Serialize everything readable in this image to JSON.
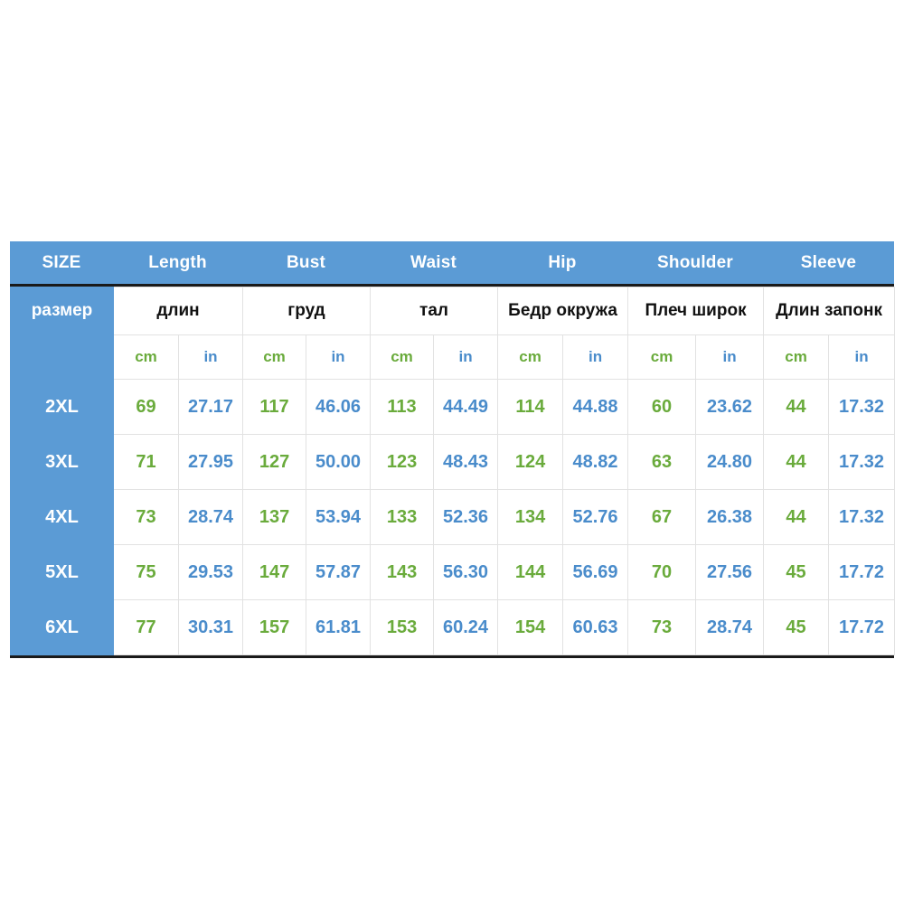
{
  "colors": {
    "header_blue": "#5B9BD5",
    "value_green": "#6AAB3C",
    "value_blue": "#4A8CCB",
    "rule_dark": "#1A1A1A",
    "grid_line": "#E2E2E2",
    "background": "#FFFFFF"
  },
  "band": {
    "labels": [
      "SIZE",
      "Length",
      "Bust",
      "Waist",
      "Hip",
      "Shoulder",
      "Sleeve"
    ]
  },
  "localized_headers": {
    "size": "размер",
    "groups": [
      "длин",
      "груд",
      "тал",
      "Бедр окружа",
      "Плеч широк",
      "Длин запонк"
    ]
  },
  "units": {
    "cm": "cm",
    "in": "in",
    "sequence": [
      "cm",
      "in",
      "cm",
      "in",
      "cm",
      "in",
      "cm",
      "in",
      "cm",
      "in",
      "cm",
      "in"
    ]
  },
  "chart_data": {
    "type": "table",
    "title": "",
    "columns": [
      "SIZE",
      "Length cm",
      "Length in",
      "Bust cm",
      "Bust in",
      "Waist cm",
      "Waist in",
      "Hip cm",
      "Hip in",
      "Shoulder cm",
      "Shoulder in",
      "Sleeve cm",
      "Sleeve in"
    ],
    "rows": [
      {
        "size": "2XL",
        "values": [
          "69",
          "27.17",
          "117",
          "46.06",
          "113",
          "44.49",
          "114",
          "44.88",
          "60",
          "23.62",
          "44",
          "17.32"
        ]
      },
      {
        "size": "3XL",
        "values": [
          "71",
          "27.95",
          "127",
          "50.00",
          "123",
          "48.43",
          "124",
          "48.82",
          "63",
          "24.80",
          "44",
          "17.32"
        ]
      },
      {
        "size": "4XL",
        "values": [
          "73",
          "28.74",
          "137",
          "53.94",
          "133",
          "52.36",
          "134",
          "52.76",
          "67",
          "26.38",
          "44",
          "17.32"
        ]
      },
      {
        "size": "5XL",
        "values": [
          "75",
          "29.53",
          "147",
          "57.87",
          "143",
          "56.30",
          "144",
          "56.69",
          "70",
          "27.56",
          "45",
          "17.72"
        ]
      },
      {
        "size": "6XL",
        "values": [
          "77",
          "30.31",
          "157",
          "61.81",
          "153",
          "60.24",
          "154",
          "60.63",
          "73",
          "28.74",
          "45",
          "17.72"
        ]
      }
    ]
  }
}
